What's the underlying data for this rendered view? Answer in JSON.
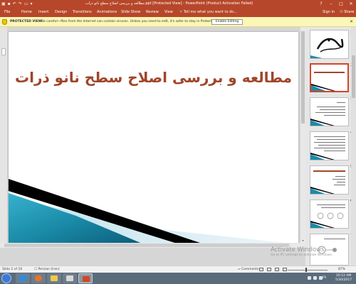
{
  "titlebar": {
    "title": "مطالعه و بررسی اصلاح سطح نانو ذرات.ppt [Protected View] - PowerPoint (Product Activation Failed)",
    "controls": [
      "?",
      "–",
      "□",
      "✕"
    ]
  },
  "ribbon": {
    "tabs": [
      "File",
      "Home",
      "Insert",
      "Design",
      "Transitions",
      "Animations",
      "Slide Show",
      "Review",
      "View"
    ],
    "tell_me": "Tell me what you want to do...",
    "sign_in": "Sign in",
    "share": "Share"
  },
  "protected_view": {
    "label": "PROTECTED VIEW",
    "message": "Be careful—files from the Internet can contain viruses. Unless you need to edit, it's safer to stay in Protected View.",
    "button": "Enable Editing",
    "close": "✕"
  },
  "slide": {
    "title": "مطالعه و بررسی اصلاح سطح نانو ذرات",
    "title_color": "#a0452a",
    "accent_colors": [
      "#1a8ba8",
      "#0b5d79",
      "#000000"
    ]
  },
  "thumbnails": [
    {
      "number": "1",
      "star": "★"
    },
    {
      "number": "2",
      "star": "★"
    },
    {
      "number": "3",
      "star": "★"
    },
    {
      "number": "4",
      "star": "★"
    },
    {
      "number": "5",
      "star": "★"
    },
    {
      "number": "6",
      "star": "★"
    },
    {
      "number": "7",
      "star": "★"
    }
  ],
  "watermark": {
    "line1": "Activate Windows",
    "line2": "Go to PC settings to activate Windows."
  },
  "status": {
    "slide_info": "Slide 2 of 16",
    "language": "Persian (Iran)",
    "comments": "Comments",
    "zoom": "87%"
  },
  "taskbar": {
    "language": "FA",
    "time": "10:12 AM",
    "date": "5/30/2017"
  }
}
